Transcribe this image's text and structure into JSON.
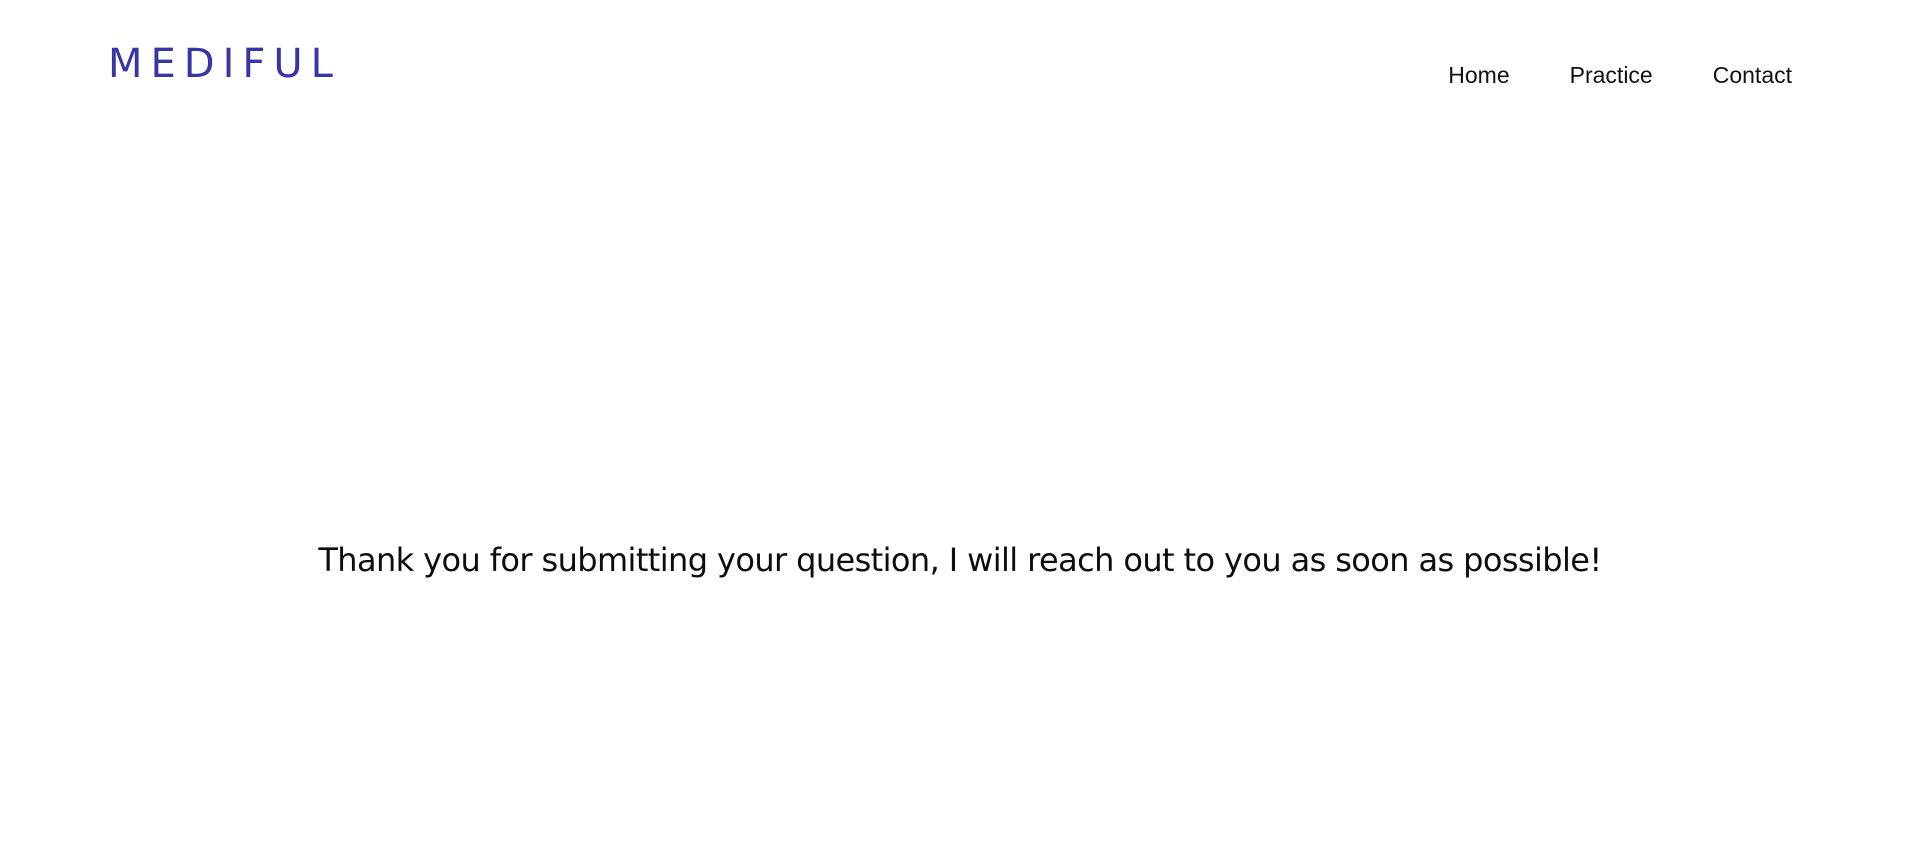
{
  "brand": {
    "logo_text": "MEDIFUL",
    "color": "#3736a6"
  },
  "nav": {
    "items": [
      {
        "label": "Home"
      },
      {
        "label": "Practice"
      },
      {
        "label": "Contact"
      }
    ]
  },
  "main": {
    "message": "Thank you for submitting your question, I will reach out to you as soon as possible!"
  }
}
